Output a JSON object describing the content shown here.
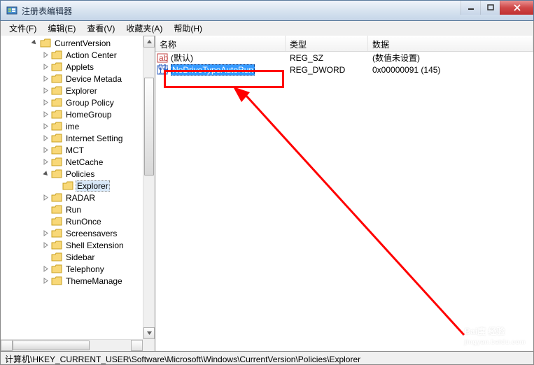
{
  "window": {
    "title": "注册表编辑器"
  },
  "menu": {
    "file": "文件(F)",
    "edit": "编辑(E)",
    "view": "查看(V)",
    "fav": "收藏夹(A)",
    "help": "帮助(H)"
  },
  "tree": {
    "root": "CurrentVersion",
    "items": [
      {
        "label": "Action Center",
        "expandable": true
      },
      {
        "label": "Applets",
        "expandable": true
      },
      {
        "label": "Device Metada",
        "expandable": true
      },
      {
        "label": "Explorer",
        "expandable": true
      },
      {
        "label": "Group Policy",
        "expandable": true
      },
      {
        "label": "HomeGroup",
        "expandable": true
      },
      {
        "label": "ime",
        "expandable": true
      },
      {
        "label": "Internet Setting",
        "expandable": true
      },
      {
        "label": "MCT",
        "expandable": true
      },
      {
        "label": "NetCache",
        "expandable": true
      },
      {
        "label": "Policies",
        "expandable": true,
        "expanded": true,
        "children": [
          {
            "label": "Explorer",
            "selected": true
          }
        ]
      },
      {
        "label": "RADAR",
        "expandable": true
      },
      {
        "label": "Run",
        "expandable": false
      },
      {
        "label": "RunOnce",
        "expandable": false
      },
      {
        "label": "Screensavers",
        "expandable": true
      },
      {
        "label": "Shell Extension",
        "expandable": true
      },
      {
        "label": "Sidebar",
        "expandable": false
      },
      {
        "label": "Telephony",
        "expandable": true
      },
      {
        "label": "ThemeManage",
        "expandable": true
      }
    ]
  },
  "list": {
    "columns": {
      "name": "名称",
      "type": "类型",
      "data": "数据"
    },
    "rows": [
      {
        "icon": "string",
        "name": "(默认)",
        "type": "REG_SZ",
        "data": "(数值未设置)",
        "selected": false
      },
      {
        "icon": "binary",
        "name": "NoDriveTypeAutoRun",
        "type": "REG_DWORD",
        "data": "0x00000091 (145)",
        "selected": true
      }
    ]
  },
  "statusbar": {
    "path": "计算机\\HKEY_CURRENT_USER\\Software\\Microsoft\\Windows\\CurrentVersion\\Policies\\Explorer"
  },
  "watermark": {
    "main": "Bai度 经验",
    "sub": "jingyan.baidu.com"
  }
}
